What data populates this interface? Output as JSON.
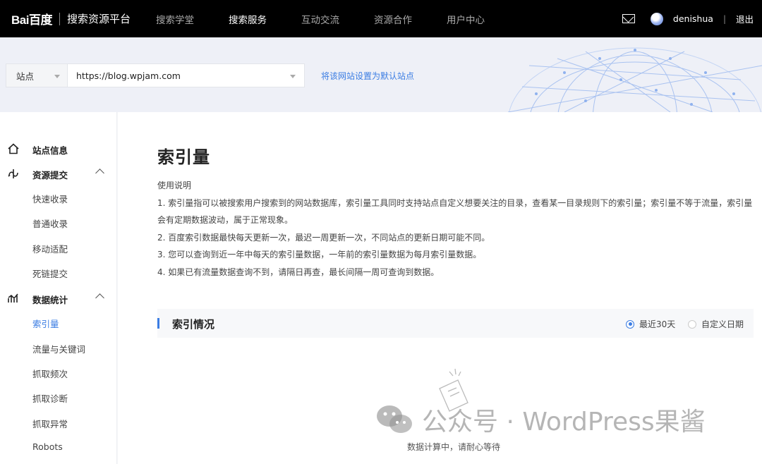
{
  "topnav": {
    "logo": "Bai百度",
    "title": "搜索资源平台",
    "items": [
      {
        "label": "搜索学堂",
        "active": false
      },
      {
        "label": "搜索服务",
        "active": true
      },
      {
        "label": "互动交流",
        "active": false
      },
      {
        "label": "资源合作",
        "active": false
      },
      {
        "label": "用户中心",
        "active": false
      }
    ],
    "username": "denishua",
    "divider": "|",
    "logout": "退出",
    "icons": [
      "mail-icon",
      "avatar"
    ]
  },
  "site": {
    "type": "站点",
    "url": "https://blog.wpjam.com",
    "set_default": "将该网站设置为默认站点"
  },
  "sidebar": {
    "groups": [
      {
        "label": "站点信息",
        "icon": "home-icon"
      },
      {
        "label": "资源提交",
        "icon": "submit-icon",
        "items": [
          "快速收录",
          "普通收录",
          "移动适配",
          "死链提交"
        ]
      },
      {
        "label": "数据统计",
        "icon": "stats-icon",
        "items": [
          "索引量",
          "流量与关键词",
          "抓取频次",
          "抓取诊断",
          "抓取异常",
          "Robots"
        ]
      }
    ],
    "active_item": "索引量"
  },
  "main": {
    "title": "索引量",
    "usage_heading": "使用说明",
    "usage_lines": [
      "1. 索引量指可以被搜索用户搜索到的网站数据库，索引量工具同时支持站点自定义想要关注的目录，查看某一目录规则下的索引量；索引量不等于流量，索引量会有定期数据波动，属于正常现象。",
      "2. 百度索引数据最快每天更新一次，最迟一周更新一次，不同站点的更新日期可能不同。",
      "3. 您可以查询到近一年中每天的索引量数据，一年前的索引量数据为每月索引量数据。",
      "4. 如果已有流量数据查询不到，请隔日再查，最长间隔一周可查询到数据。"
    ],
    "section_title": "索引情况",
    "range_options": [
      {
        "label": "最近30天",
        "checked": true
      },
      {
        "label": "自定义日期",
        "checked": false
      }
    ],
    "empty_text": "数据计算中，请耐心等待",
    "watermark": "公众号 · WordPress果酱"
  },
  "colors": {
    "accent": "#3b7de3",
    "nav_bg": "#000000"
  }
}
